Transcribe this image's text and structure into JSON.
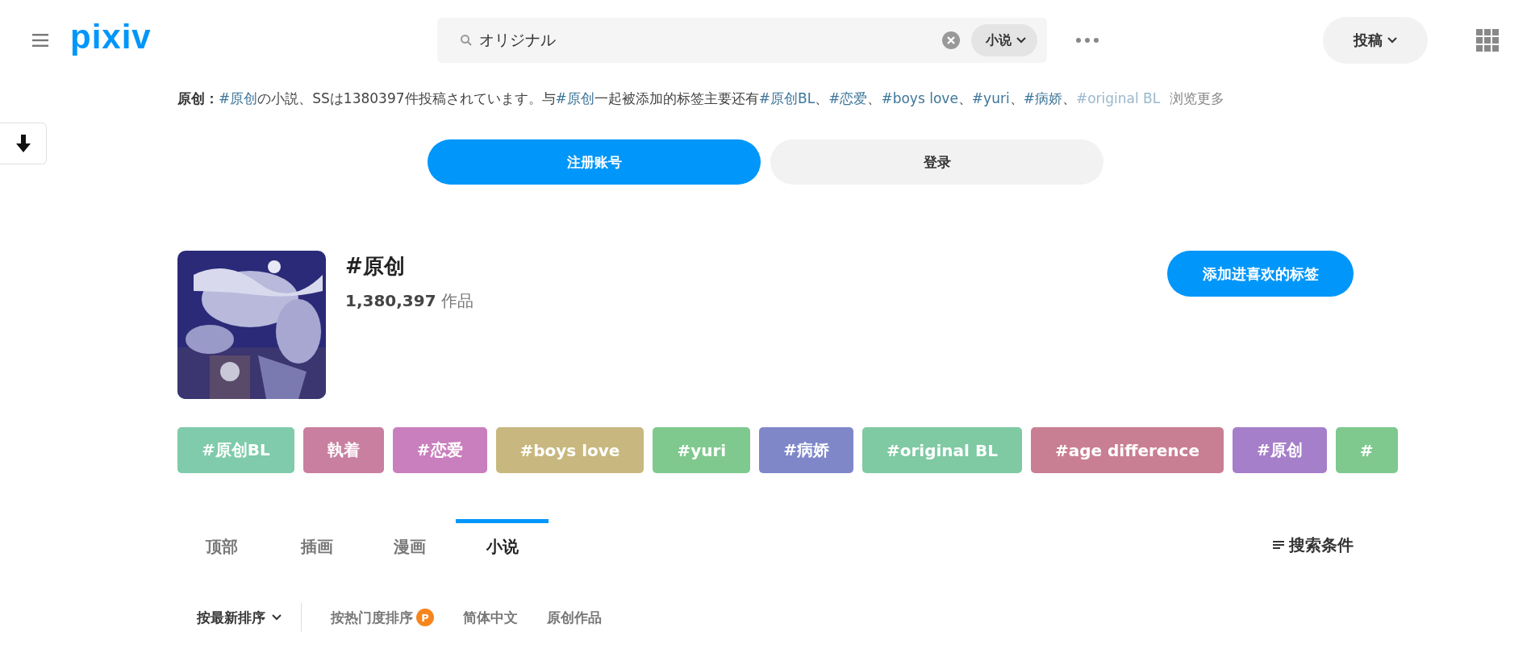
{
  "header": {
    "logo": "pixiv",
    "search": {
      "value": "オリジナル",
      "scope": "小说"
    },
    "post_button": "投稿"
  },
  "description": [
    {
      "kind": "label",
      "text": "原创："
    },
    {
      "kind": "link",
      "text": "#原创"
    },
    {
      "kind": "text",
      "text": "の小説、SSは1380397件投稿されています。与"
    },
    {
      "kind": "link",
      "text": "#原创"
    },
    {
      "kind": "text",
      "text": "一起被添加的标签主要还有"
    },
    {
      "kind": "link",
      "text": "#原创BL"
    },
    {
      "kind": "text",
      "text": "、"
    },
    {
      "kind": "link",
      "text": "#恋爱"
    },
    {
      "kind": "text",
      "text": "、"
    },
    {
      "kind": "link",
      "text": "#boys love"
    },
    {
      "kind": "text",
      "text": "、"
    },
    {
      "kind": "link",
      "text": "#yuri"
    },
    {
      "kind": "text",
      "text": "、"
    },
    {
      "kind": "link",
      "text": "#病娇"
    },
    {
      "kind": "text",
      "text": "、"
    },
    {
      "kind": "link",
      "text": "#original BL"
    }
  ],
  "more_link": "浏览更多",
  "auth_buttons": [
    {
      "label": "注册账号",
      "kind": "primary"
    },
    {
      "label": "登录",
      "kind": "secondary"
    }
  ],
  "tag": {
    "title": "#原创",
    "count": "1,380,397",
    "count_unit": "作品",
    "add_button": "添加进喜欢的标签"
  },
  "related_tags": [
    {
      "label": "#原创BL",
      "color": "#7fcbab"
    },
    {
      "label": "執着",
      "color": "#c97f9f"
    },
    {
      "label": "#恋爱",
      "color": "#c97fbd"
    },
    {
      "label": "#boys love",
      "color": "#c8b87f"
    },
    {
      "label": "#yuri",
      "color": "#7fc98f"
    },
    {
      "label": "#病娇",
      "color": "#7f87c9"
    },
    {
      "label": "#original BL",
      "color": "#7fc9a3"
    },
    {
      "label": "#age difference",
      "color": "#c97f93"
    },
    {
      "label": "#原创",
      "color": "#a57fc9"
    },
    {
      "label": "#",
      "color": "#7fc98f"
    }
  ],
  "tabs": [
    {
      "label": "顶部",
      "selected": false
    },
    {
      "label": "插画",
      "selected": false
    },
    {
      "label": "漫画",
      "selected": false
    },
    {
      "label": "小说",
      "selected": true
    }
  ],
  "search_options": "搜索条件",
  "sort": [
    {
      "label": "按最新排序",
      "kind": "dropdown",
      "selected": true
    },
    {
      "label": "按热门度排序",
      "kind": "premium",
      "badge": "P",
      "selected": false
    },
    {
      "label": "简体中文",
      "kind": "plain",
      "selected": false
    },
    {
      "label": "原创作品",
      "kind": "plain",
      "selected": false
    }
  ]
}
